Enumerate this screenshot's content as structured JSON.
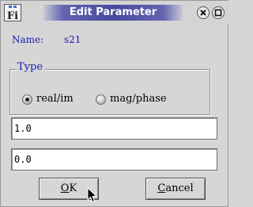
{
  "window": {
    "title": "Edit Parameter"
  },
  "name_row": {
    "label": "Name:",
    "value": "s21"
  },
  "type_group": {
    "legend": "Type",
    "options": [
      {
        "label": "real/im",
        "selected": true
      },
      {
        "label": "mag/phase",
        "selected": false
      }
    ]
  },
  "fields": {
    "value1": "1.0",
    "value2": "0.0"
  },
  "buttons": {
    "ok_rest": "K",
    "ok_mnemonic": "O",
    "cancel_mnemonic": "C",
    "cancel_rest": "ancel"
  },
  "colors": {
    "label_blue": "#1a1ab4",
    "title_gradient": "#4848a0"
  },
  "icons": {
    "app": "fi-app-icon",
    "close": "close-icon",
    "maximize": "maximize-icon",
    "cursor": "mouse-pointer-icon"
  }
}
